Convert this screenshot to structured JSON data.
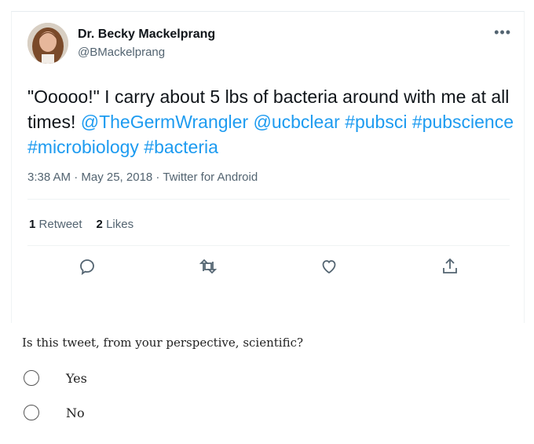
{
  "tweet": {
    "author_name": "Dr. Becky Mackelprang",
    "handle": "@BMackelprang",
    "more_icon": "•••",
    "text_parts": {
      "intro": "\"Ooooo!\" I carry about 5 lbs of bacteria around with me at all times! ",
      "mention1": "@TheGermWrangler",
      "space1": " ",
      "mention2": "@ucbclear",
      "space2": " ",
      "tag1": "#pubsci",
      "space3": " ",
      "tag2": "#pubscience",
      "space4": " ",
      "tag3": "#microbiology",
      "space5": " ",
      "tag4": "#bacteria"
    },
    "meta": "3:38 AM · May 25, 2018 · Twitter for Android",
    "retweet_count": "1",
    "retweet_label": "Retweet",
    "like_count": "2",
    "like_label": "Likes",
    "icons": {
      "reply": "reply-icon",
      "retweet": "retweet-icon",
      "like": "heart-icon",
      "share": "share-icon"
    },
    "colors": {
      "link": "#1d9bf0",
      "text": "#0f1419",
      "secondary": "#536471"
    }
  },
  "survey": {
    "question": "Is this tweet, from your perspective, scientific?",
    "options": [
      "Yes",
      "No"
    ]
  }
}
